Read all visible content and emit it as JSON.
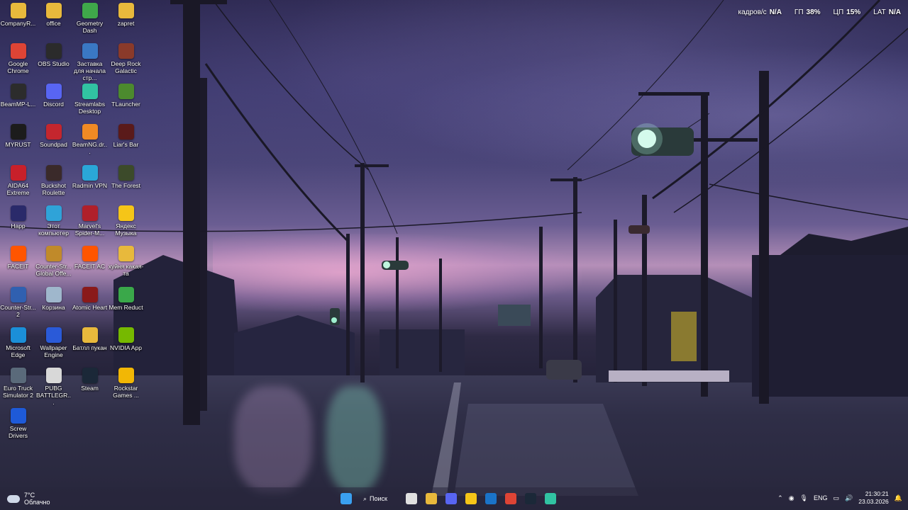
{
  "overlay": {
    "fps_label": "кадров/с",
    "fps_value": "N/A",
    "gpu_label": "ГП",
    "gpu_value": "38%",
    "cpu_label": "ЦП",
    "cpu_value": "15%",
    "lat_label": "LAT",
    "lat_value": "N/A"
  },
  "desktop_icons": [
    {
      "label": "CompanyR...",
      "icon": "folder-icon",
      "color": "#e8b93c"
    },
    {
      "label": "office",
      "icon": "folder-icon",
      "color": "#e8b93c"
    },
    {
      "label": "Geometry Dash",
      "icon": "geometry-dash-icon",
      "color": "#3fa84a"
    },
    {
      "label": "zapret",
      "icon": "folder-icon",
      "color": "#e8b93c"
    },
    {
      "label": "Google Chrome",
      "icon": "chrome-icon",
      "color": "#de4435"
    },
    {
      "label": "OBS Studio",
      "icon": "obs-icon",
      "color": "#2b2b2b"
    },
    {
      "label": "Заставка для начала стр...",
      "icon": "video-icon",
      "color": "#3a78c3"
    },
    {
      "label": "Deep Rock Galactic",
      "icon": "deep-rock-galactic-icon",
      "color": "#8a3a2a"
    },
    {
      "label": "BeamMP-L...",
      "icon": "beammp-icon",
      "color": "#2c2c2c"
    },
    {
      "label": "Discord",
      "icon": "discord-icon",
      "color": "#5865f2"
    },
    {
      "label": "Streamlabs Desktop",
      "icon": "streamlabs-icon",
      "color": "#31c3a2"
    },
    {
      "label": "TLauncher",
      "icon": "tlauncher-icon",
      "color": "#4c8a2e"
    },
    {
      "label": "MYRUST",
      "icon": "myrust-icon",
      "color": "#1c1c1c"
    },
    {
      "label": "Soundpad",
      "icon": "soundpad-icon",
      "color": "#c4262e"
    },
    {
      "label": "BeamNG.dr...",
      "icon": "beamng-icon",
      "color": "#f08a24"
    },
    {
      "label": "Liar's Bar",
      "icon": "liars-bar-icon",
      "color": "#5a1a1a"
    },
    {
      "label": "AIDA64 Extreme",
      "icon": "aida64-icon",
      "color": "#c8202a"
    },
    {
      "label": "Buckshot Roulette",
      "icon": "buckshot-roulette-icon",
      "color": "#3a2a2a"
    },
    {
      "label": "Radmin VPN",
      "icon": "radmin-vpn-icon",
      "color": "#2aa7d8"
    },
    {
      "label": "The Forest",
      "icon": "the-forest-icon",
      "color": "#3c4a2a"
    },
    {
      "label": "Happ",
      "icon": "happ-icon",
      "color": "#2a2a6a"
    },
    {
      "label": "Этот компьютер",
      "icon": "this-pc-icon",
      "color": "#2fa3d8"
    },
    {
      "label": "Marvel's Spider-M...",
      "icon": "spider-man-icon",
      "color": "#b0202a"
    },
    {
      "label": "Яндекс Музыка",
      "icon": "yandex-music-icon",
      "color": "#f5c518"
    },
    {
      "label": "FACEIT",
      "icon": "faceit-icon",
      "color": "#ff5500"
    },
    {
      "label": "Counter-Str... Global Offe...",
      "icon": "csgo-icon",
      "color": "#c08a2a"
    },
    {
      "label": "FACEIT AC",
      "icon": "faceit-ac-icon",
      "color": "#ff5500"
    },
    {
      "label": "хуйня какая-та",
      "icon": "folder-icon",
      "color": "#e8b93c"
    },
    {
      "label": "Counter-Str... 2",
      "icon": "cs2-icon",
      "color": "#3060b0"
    },
    {
      "label": "Корзина",
      "icon": "recycle-bin-icon",
      "color": "#9fb7cc"
    },
    {
      "label": "Atomic Heart",
      "icon": "atomic-heart-icon",
      "color": "#8a1a1a"
    },
    {
      "label": "Mem Reduct",
      "icon": "mem-reduct-icon",
      "color": "#3aa84a"
    },
    {
      "label": "Microsoft Edge",
      "icon": "edge-icon",
      "color": "#1b8fd8"
    },
    {
      "label": "Wallpaper Engine",
      "icon": "wallpaper-engine-icon",
      "color": "#2a5ad8"
    },
    {
      "label": "Батлл пукан",
      "icon": "folder-icon",
      "color": "#e8b93c"
    },
    {
      "label": "NVIDIA App",
      "icon": "nvidia-icon",
      "color": "#76b900"
    },
    {
      "label": "Euro Truck Simulator 2",
      "icon": "euro-truck-icon",
      "color": "#5a6a7a"
    },
    {
      "label": "PUBG BATTLEGR...",
      "icon": "pubg-icon",
      "color": "#d8d8d8"
    },
    {
      "label": "Steam",
      "icon": "steam-icon",
      "color": "#1b2838"
    },
    {
      "label": "Rockstar Games ...",
      "icon": "rockstar-icon",
      "color": "#f2b705"
    },
    {
      "label": "Screw Drivers",
      "icon": "screw-drivers-icon",
      "color": "#1e5ad8"
    }
  ],
  "taskbar": {
    "weather_temp": "7°C",
    "weather_text": "Облачно",
    "search_label": "Поиск",
    "apps": [
      {
        "name": "start",
        "icon": "windows-start-icon",
        "color": "#3aa0f0"
      },
      {
        "name": "task-view",
        "icon": "task-view-icon",
        "color": "#e0e0e0"
      },
      {
        "name": "file-explorer",
        "icon": "folder-icon",
        "color": "#e8b93c"
      },
      {
        "name": "discord",
        "icon": "discord-icon",
        "color": "#5865f2"
      },
      {
        "name": "yandex-music",
        "icon": "yandex-music-icon",
        "color": "#f5c518"
      },
      {
        "name": "outlook",
        "icon": "outlook-icon",
        "color": "#1a73c8"
      },
      {
        "name": "chrome",
        "icon": "chrome-icon",
        "color": "#de4435"
      },
      {
        "name": "steam",
        "icon": "steam-icon",
        "color": "#1b2838"
      },
      {
        "name": "streamlabs",
        "icon": "streamlabs-icon",
        "color": "#31c3a2"
      }
    ],
    "language": "ENG",
    "time": "21:30:21",
    "date": "23.03.2026"
  }
}
